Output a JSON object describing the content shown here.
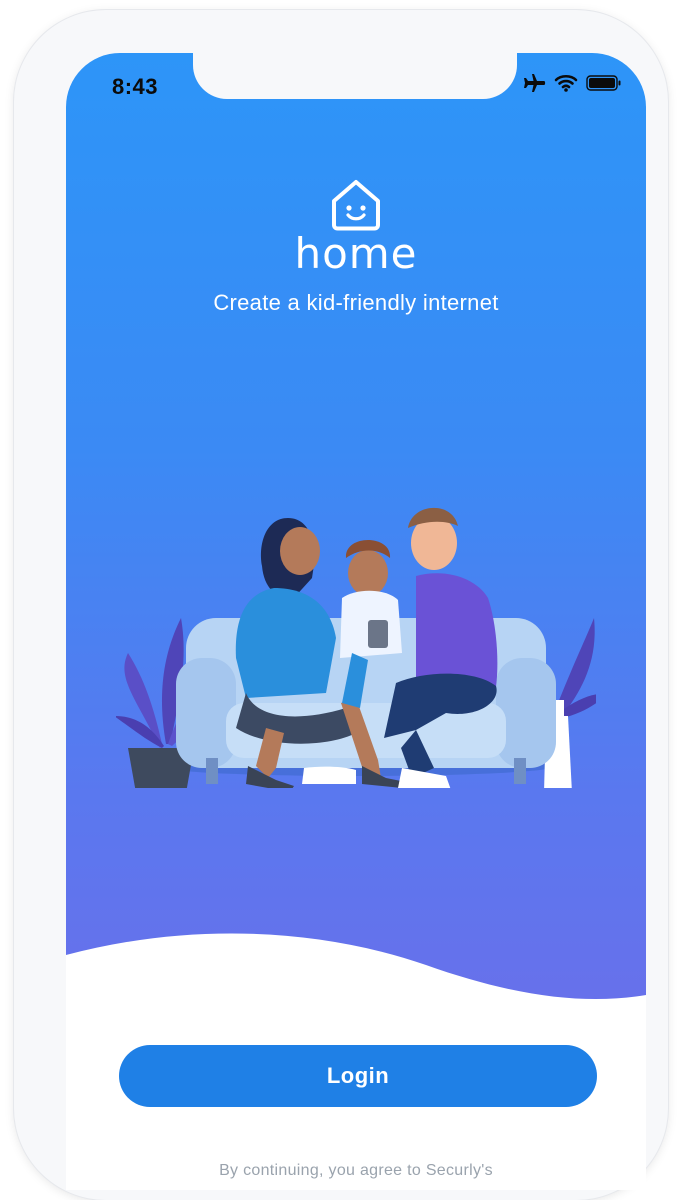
{
  "status_bar": {
    "time": "8:43",
    "icons": [
      "airplane-icon",
      "wifi-icon",
      "battery-icon"
    ]
  },
  "brand": {
    "logo_icon": "smiling-house-icon",
    "name": "home",
    "tagline": "Create a kid-friendly internet"
  },
  "illustration": {
    "name": "family-on-couch-illustration"
  },
  "actions": {
    "login_label": "Login"
  },
  "legal": {
    "text": "By continuing, you agree to Securly's"
  },
  "colors": {
    "gradient_top": "#2d95f8",
    "gradient_bottom": "#6a6fea",
    "button": "#1f80e6",
    "legal_text": "#9aa3ad"
  }
}
